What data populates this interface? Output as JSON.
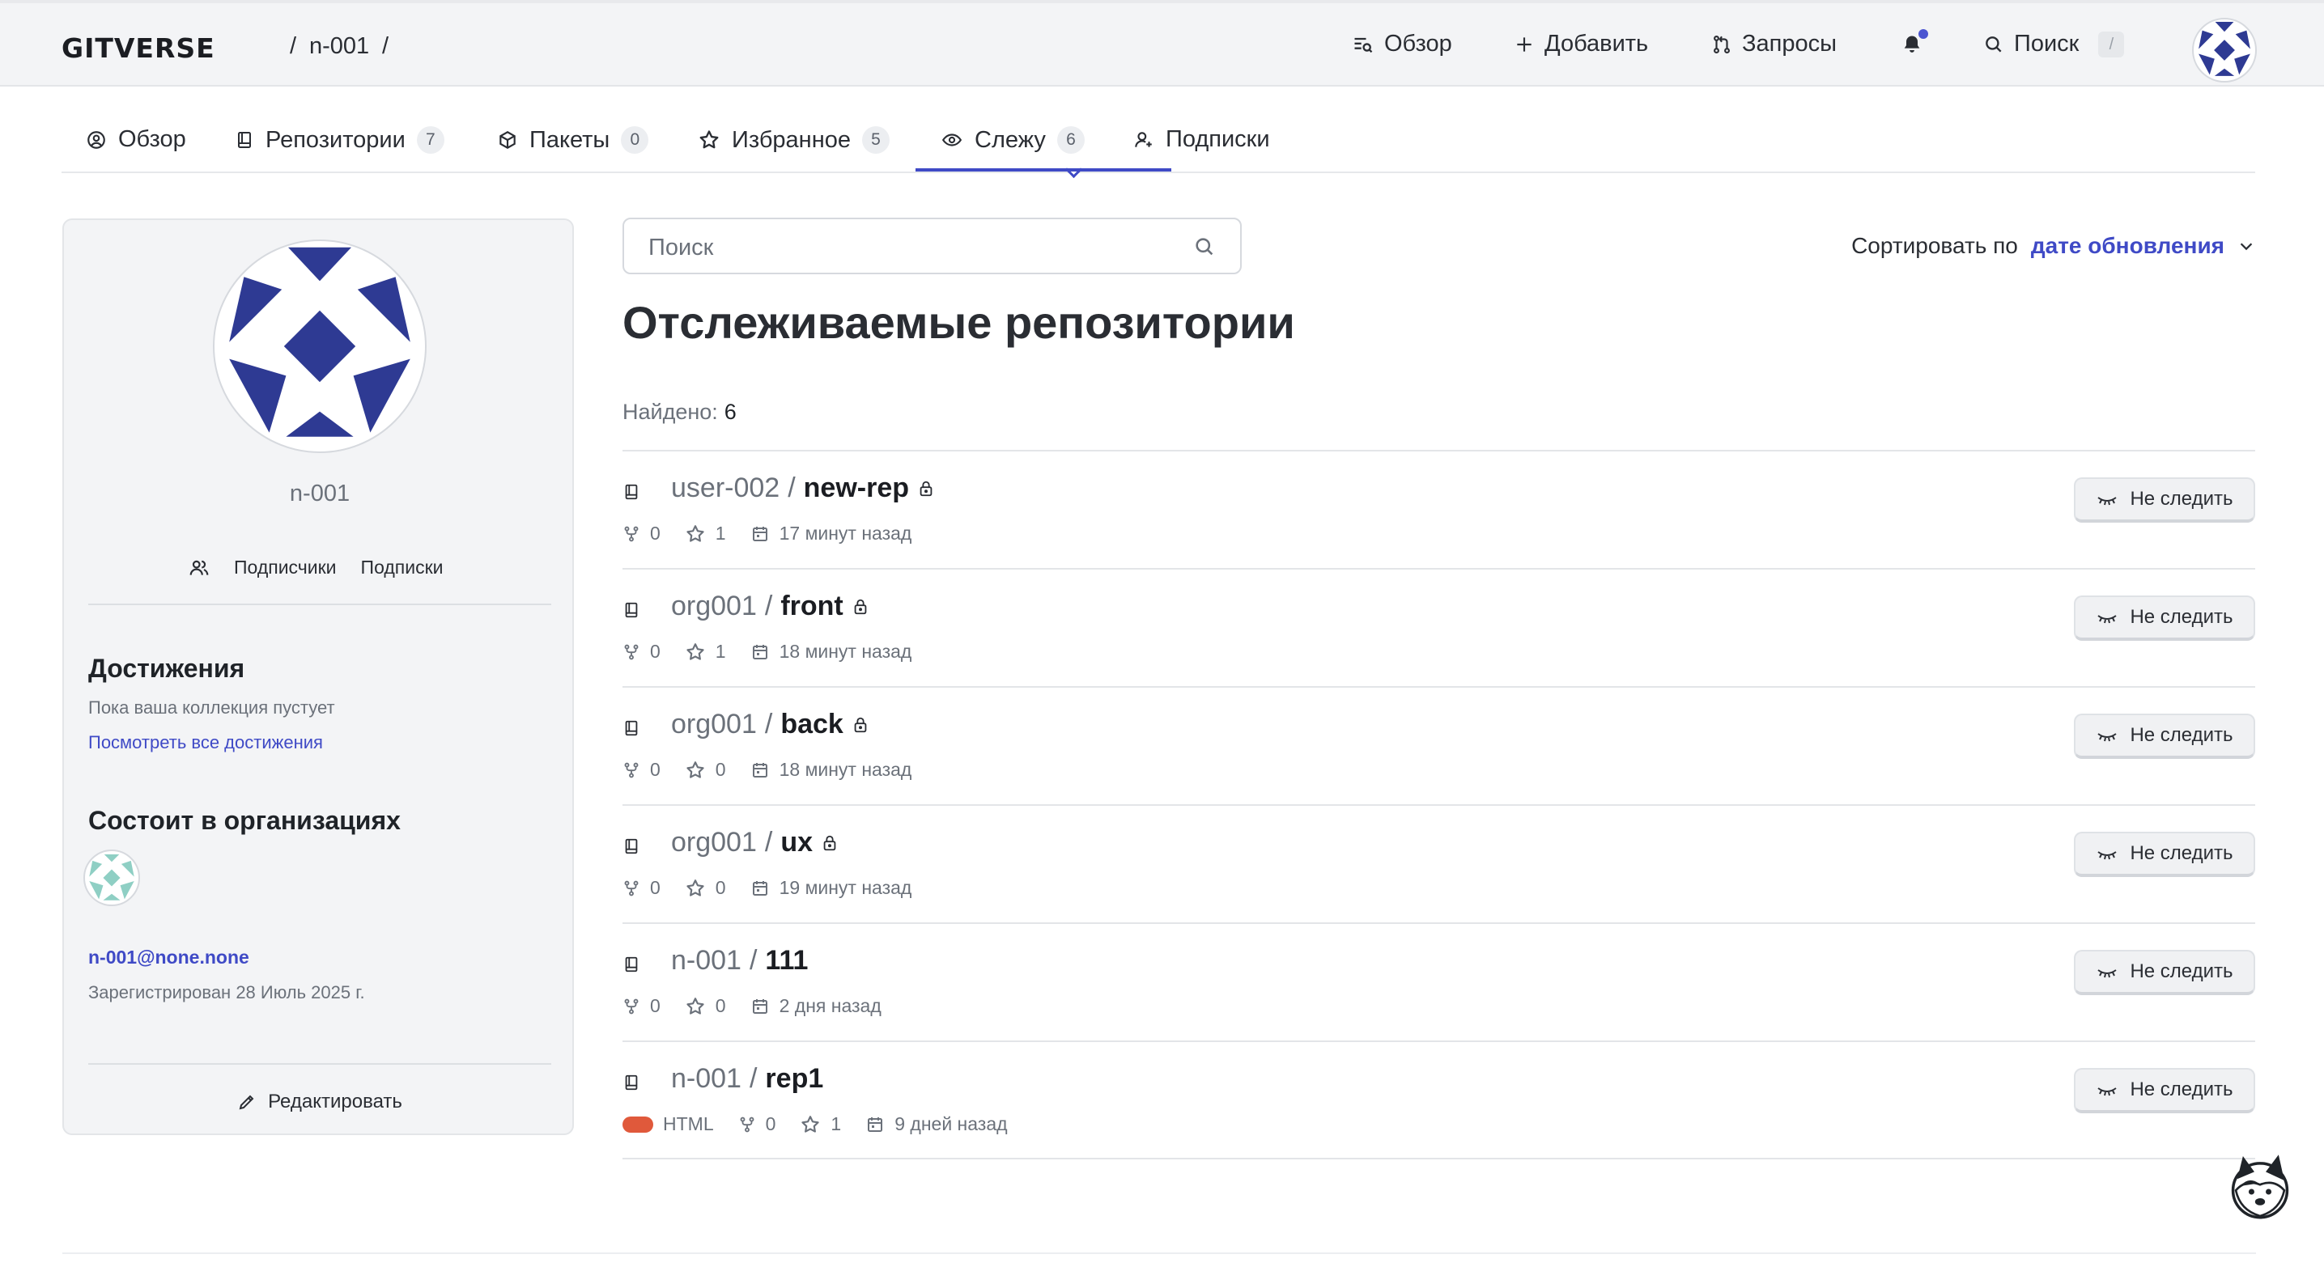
{
  "header": {
    "logo": "GITVERSE",
    "crumb_sep1": "/",
    "crumb_user": "n-001",
    "crumb_sep2": "/",
    "nav": {
      "overview": "Обзор",
      "add": "Добавить",
      "requests": "Запросы",
      "search": "Поиск",
      "search_shortcut": "/"
    },
    "notification_dot_color": "#4b55d1"
  },
  "tabs": [
    {
      "label": "Обзор",
      "icon": "user-circle-icon"
    },
    {
      "label": "Репозитории",
      "count": "7",
      "icon": "repo-icon"
    },
    {
      "label": "Пакеты",
      "count": "0",
      "icon": "package-icon"
    },
    {
      "label": "Избранное",
      "count": "5",
      "icon": "star-icon"
    },
    {
      "label": "Слежу",
      "count": "6",
      "icon": "eye-icon",
      "active": true
    },
    {
      "label": "Подписки",
      "icon": "person-add-icon"
    }
  ],
  "profile": {
    "username": "n-001",
    "followers_label": "Подписчики",
    "following_label": "Подписки",
    "achievements_title": "Достижения",
    "achievements_empty": "Пока ваша коллекция пустует",
    "achievements_link": "Посмотреть все достижения",
    "orgs_title": "Состоит в организациях",
    "email": "n-001@none.none",
    "registered": "Зарегистрирован 28 Июль 2025 г.",
    "edit_label": "Редактировать"
  },
  "main": {
    "search_placeholder": "Поиск",
    "sort_label": "Сортировать по",
    "sort_value": "дате обновления",
    "title": "Отслеживаемые репозитории",
    "found_label": "Найдено:",
    "found_count": "6",
    "unwatch_label": "Не следить",
    "repos": [
      {
        "owner": "user-002",
        "name": "new-rep",
        "private": true,
        "forks": "0",
        "stars": "1",
        "updated": "17 минут назад"
      },
      {
        "owner": "org001",
        "name": "front",
        "private": true,
        "forks": "0",
        "stars": "1",
        "updated": "18 минут назад"
      },
      {
        "owner": "org001",
        "name": "back",
        "private": true,
        "forks": "0",
        "stars": "0",
        "updated": "18 минут назад"
      },
      {
        "owner": "org001",
        "name": "ux",
        "private": true,
        "forks": "0",
        "stars": "0",
        "updated": "19 минут назад"
      },
      {
        "owner": "n-001",
        "name": "111",
        "private": false,
        "forks": "0",
        "stars": "0",
        "updated": "2 дня назад"
      },
      {
        "owner": "n-001",
        "name": "rep1",
        "private": false,
        "language": "HTML",
        "language_color": "#e0593b",
        "forks": "0",
        "stars": "1",
        "updated": "9 дней назад"
      }
    ]
  },
  "colors": {
    "accent": "#3f4ac6",
    "avatar_blue": "#2e3a93"
  }
}
